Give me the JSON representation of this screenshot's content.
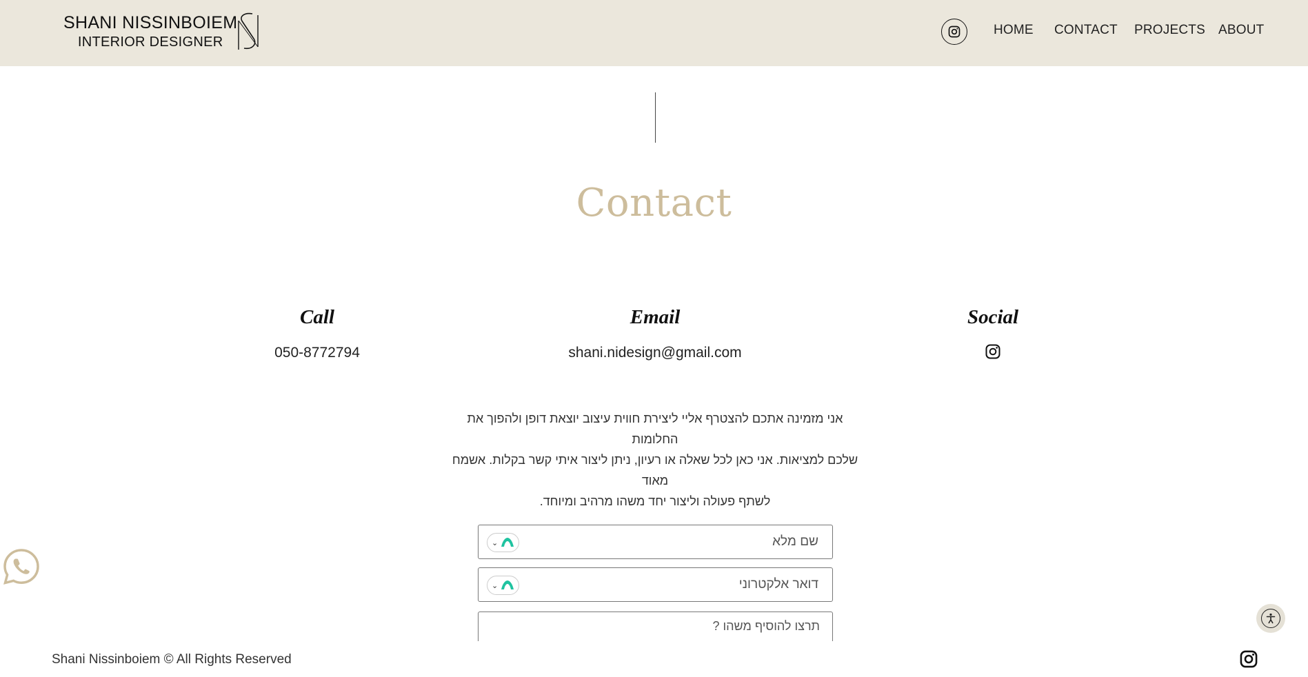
{
  "header": {
    "logo_line1": "SHANI NISSINBOIEM",
    "logo_line2": "INTERIOR DESIGNER",
    "nav": [
      "HOME",
      "CONTACT",
      "PROJECTS",
      "ABOUT"
    ],
    "background": "#ebe7dc"
  },
  "main": {
    "title": "Contact",
    "title_color": "#cdbd9c",
    "columns": {
      "call": {
        "heading": "Call",
        "value": "050-8772794"
      },
      "email": {
        "heading": "Email",
        "value": "shani.nidesign@gmail.com"
      },
      "social": {
        "heading": "Social",
        "icon": "instagram-icon"
      }
    },
    "paragraph_lines": [
      "אני מזמינה אתכם להצטרף אליי ליצירת חווית עיצוב יוצאת דופן ולהפוך את  החלומות",
      "שלכם למציאות. אני כאן לכל שאלה או רעיון, ניתן ליצור איתי קשר בקלות. אשמח מאוד",
      "לשתף פעולה וליצור יחד משהו מרהיב ומיוחד."
    ]
  },
  "form": {
    "name_placeholder": "שם מלא",
    "email_placeholder": "דואר אלקטרוני",
    "message_placeholder": "תרצו להוסיף משהו ?"
  },
  "footer": {
    "copyright": "Shani Nissinboiem © All Rights Reserved"
  },
  "floating": {
    "whatsapp_icon": "whatsapp-icon",
    "accessibility_icon": "accessibility-icon"
  }
}
